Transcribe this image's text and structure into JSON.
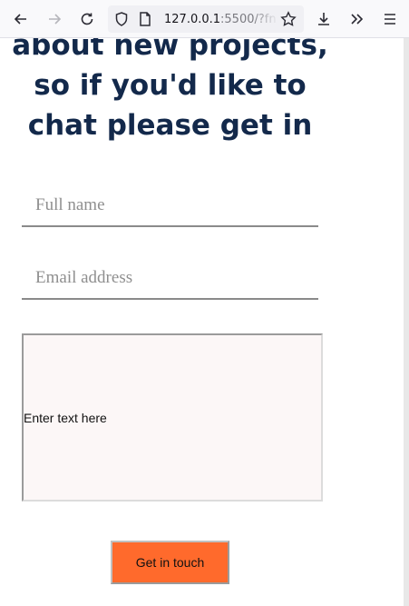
{
  "browser": {
    "url_host": "127.0.0.1",
    "url_rest": ":5500/?fna",
    "icons": {
      "back": "arrow-left-icon",
      "forward": "arrow-right-icon",
      "reload": "reload-icon",
      "shield": "shield-icon",
      "page": "page-icon",
      "star": "star-icon",
      "download": "download-icon",
      "overflow": "chevrons-right-icon",
      "menu": "hamburger-menu-icon"
    }
  },
  "page": {
    "heading_lines": [
      "about new projects,",
      "so if you'd like to",
      "chat please get in"
    ],
    "form": {
      "name_placeholder": "Full name",
      "email_placeholder": "Email address",
      "message_placeholder": "Enter text here",
      "submit_label": "Get in touch"
    }
  },
  "colors": {
    "heading": "#13294b",
    "submit_bg": "#ff6a2c",
    "message_bg": "#fcf7f7"
  }
}
